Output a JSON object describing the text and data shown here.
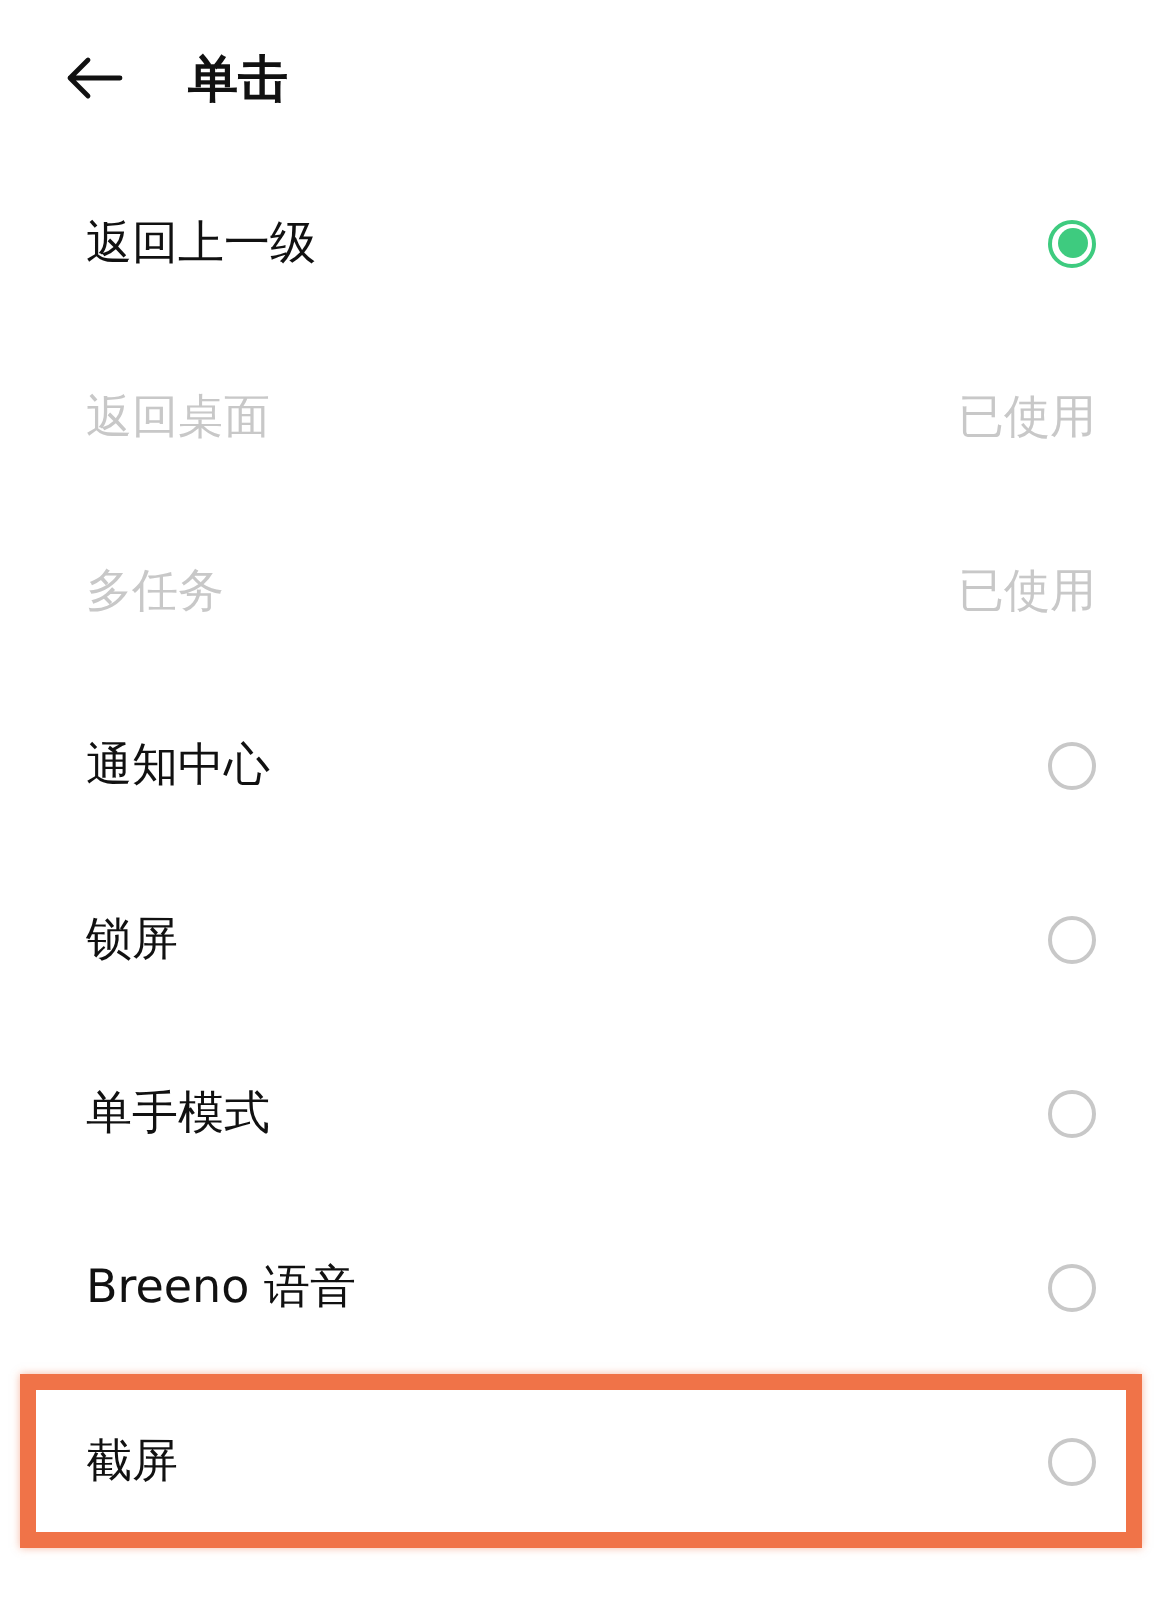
{
  "header": {
    "title": "单击"
  },
  "options": [
    {
      "label": "返回上一级",
      "kind": "radio",
      "selected": true,
      "highlighted": false
    },
    {
      "label": "返回桌面",
      "kind": "used",
      "status": "已使用",
      "highlighted": false
    },
    {
      "label": "多任务",
      "kind": "used",
      "status": "已使用",
      "highlighted": false
    },
    {
      "label": "通知中心",
      "kind": "radio",
      "selected": false,
      "highlighted": false
    },
    {
      "label": "锁屏",
      "kind": "radio",
      "selected": false,
      "highlighted": false
    },
    {
      "label": "单手模式",
      "kind": "radio",
      "selected": false,
      "highlighted": false
    },
    {
      "label": "Breeno 语音",
      "kind": "radio",
      "selected": false,
      "highlighted": false
    },
    {
      "label": "截屏",
      "kind": "radio",
      "selected": false,
      "highlighted": true
    }
  ]
}
